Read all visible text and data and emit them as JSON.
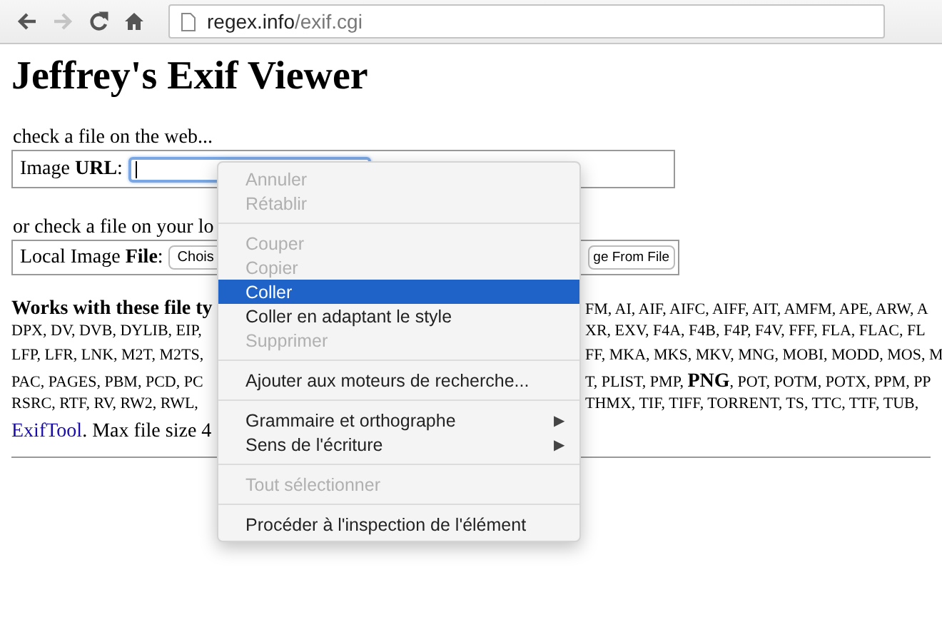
{
  "toolbar": {
    "back_disabled": false,
    "forward_disabled": true,
    "url_host": "regex.info",
    "url_path": "/exif.cgi"
  },
  "page": {
    "title": "Jeffrey's Exif Viewer",
    "web_label": "check a file on the web...",
    "url_label": "Image **URL**:",
    "local_label": "or check a file on your lo",
    "file_label": "Local Image **File**:",
    "choose_button": "Chois",
    "submit_button": "ge From File",
    "works_heading": "Works with these file ty",
    "types_lines": [
      {
        "right": "FM, AI, AIF, AIFC, AIFF, AIT, AMFM, APE, ARW, A"
      },
      {
        "left": "DPX, DV, DVB, DYLIB, EIP,",
        "right": "XR, EXV, F4A, F4B, F4P, F4V, FFF, FLA, FLAC, FL"
      },
      {
        "left": "LFP, LFR, LNK, M2T, M2TS,",
        "right": "FF, MKA, MKS, MKV, MNG, MOBI, MODD, MOS, M"
      },
      {
        "left": "PAC, PAGES, PBM, PCD, PC",
        "right": "T, PLIST, PMP, **PNG**, POT, POTM, POTX, PPM, PP"
      },
      {
        "left": "RSRC, RTF, RV, RW2, RWL,",
        "right": "THMX, TIF, TIFF, TORRENT, TS, TTC, TTF, TUB,"
      }
    ],
    "exiftool_link": "ExifTool",
    "max_size": ". Max file size 4"
  },
  "context_menu": [
    {
      "kind": "item",
      "label": "Annuler",
      "disabled": true,
      "selected": false
    },
    {
      "kind": "item",
      "label": "Rétablir",
      "disabled": true,
      "selected": false
    },
    {
      "kind": "separator"
    },
    {
      "kind": "item",
      "label": "Couper",
      "disabled": true,
      "selected": false
    },
    {
      "kind": "item",
      "label": "Copier",
      "disabled": true,
      "selected": false
    },
    {
      "kind": "item",
      "label": "Coller",
      "disabled": false,
      "selected": true
    },
    {
      "kind": "item",
      "label": "Coller en adaptant le style",
      "disabled": false,
      "selected": false
    },
    {
      "kind": "item",
      "label": "Supprimer",
      "disabled": true,
      "selected": false
    },
    {
      "kind": "separator"
    },
    {
      "kind": "item",
      "label": "Ajouter aux moteurs de recherche...",
      "disabled": false,
      "selected": false
    },
    {
      "kind": "separator"
    },
    {
      "kind": "submenu",
      "label": "Grammaire et orthographe",
      "disabled": false,
      "selected": false,
      "arrow": "▶"
    },
    {
      "kind": "submenu",
      "label": "Sens de l'écriture",
      "disabled": false,
      "selected": false,
      "arrow": "▶"
    },
    {
      "kind": "separator"
    },
    {
      "kind": "item",
      "label": "Tout sélectionner",
      "disabled": true,
      "selected": false
    },
    {
      "kind": "separator"
    },
    {
      "kind": "item",
      "label": "Procéder à l'inspection de l'élément",
      "disabled": false,
      "selected": false
    }
  ]
}
